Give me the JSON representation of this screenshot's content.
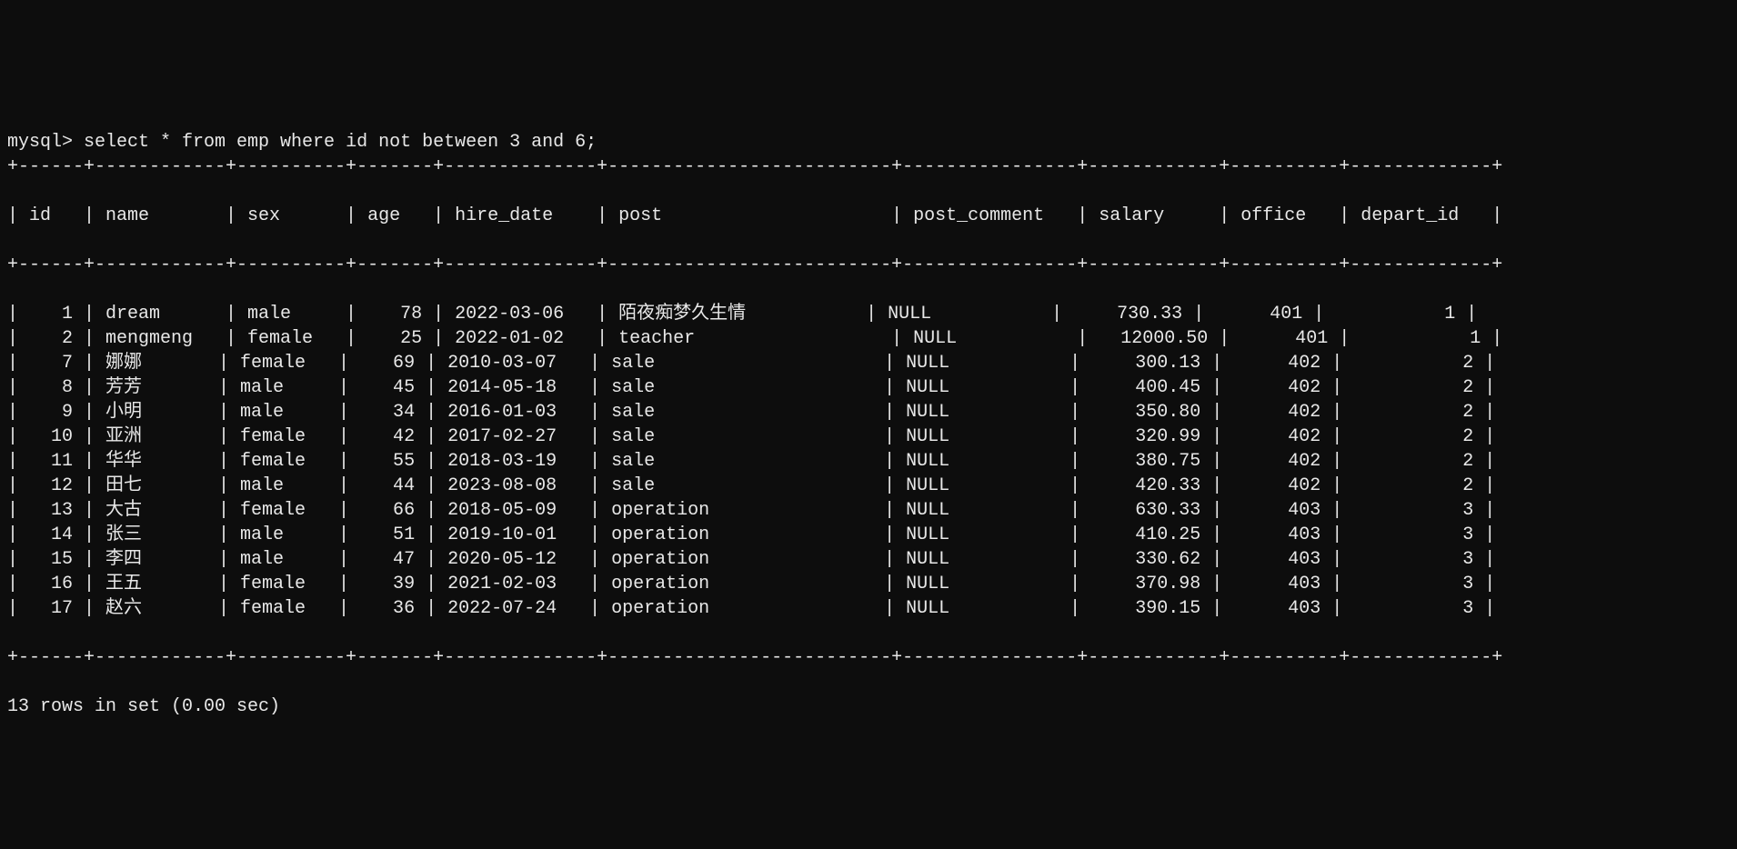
{
  "prompt": "mysql> ",
  "query": "select * from emp where id not between 3 and 6;",
  "columns": [
    {
      "name": "id",
      "width": 4,
      "align": "right"
    },
    {
      "name": "name",
      "width": 10,
      "align": "left"
    },
    {
      "name": "sex",
      "width": 8,
      "align": "left"
    },
    {
      "name": "age",
      "width": 5,
      "align": "right"
    },
    {
      "name": "hire_date",
      "width": 12,
      "align": "left"
    },
    {
      "name": "post",
      "width": 24,
      "align": "left"
    },
    {
      "name": "post_comment",
      "width": 14,
      "align": "left"
    },
    {
      "name": "salary",
      "width": 10,
      "align": "right"
    },
    {
      "name": "office",
      "width": 8,
      "align": "right"
    },
    {
      "name": "depart_id",
      "width": 11,
      "align": "right"
    }
  ],
  "rows": [
    {
      "id": "1",
      "name": "dream",
      "sex": "male",
      "age": "78",
      "hire_date": "2022-03-06",
      "post": "陌夜痴梦久生情",
      "post_comment": "NULL",
      "salary": "730.33",
      "office": "401",
      "depart_id": "1"
    },
    {
      "id": "2",
      "name": "mengmeng",
      "sex": "female",
      "age": "25",
      "hire_date": "2022-01-02",
      "post": "teacher",
      "post_comment": "NULL",
      "salary": "12000.50",
      "office": "401",
      "depart_id": "1"
    },
    {
      "id": "7",
      "name": "娜娜",
      "sex": "female",
      "age": "69",
      "hire_date": "2010-03-07",
      "post": "sale",
      "post_comment": "NULL",
      "salary": "300.13",
      "office": "402",
      "depart_id": "2"
    },
    {
      "id": "8",
      "name": "芳芳",
      "sex": "male",
      "age": "45",
      "hire_date": "2014-05-18",
      "post": "sale",
      "post_comment": "NULL",
      "salary": "400.45",
      "office": "402",
      "depart_id": "2"
    },
    {
      "id": "9",
      "name": "小明",
      "sex": "male",
      "age": "34",
      "hire_date": "2016-01-03",
      "post": "sale",
      "post_comment": "NULL",
      "salary": "350.80",
      "office": "402",
      "depart_id": "2"
    },
    {
      "id": "10",
      "name": "亚洲",
      "sex": "female",
      "age": "42",
      "hire_date": "2017-02-27",
      "post": "sale",
      "post_comment": "NULL",
      "salary": "320.99",
      "office": "402",
      "depart_id": "2"
    },
    {
      "id": "11",
      "name": "华华",
      "sex": "female",
      "age": "55",
      "hire_date": "2018-03-19",
      "post": "sale",
      "post_comment": "NULL",
      "salary": "380.75",
      "office": "402",
      "depart_id": "2"
    },
    {
      "id": "12",
      "name": "田七",
      "sex": "male",
      "age": "44",
      "hire_date": "2023-08-08",
      "post": "sale",
      "post_comment": "NULL",
      "salary": "420.33",
      "office": "402",
      "depart_id": "2"
    },
    {
      "id": "13",
      "name": "大古",
      "sex": "female",
      "age": "66",
      "hire_date": "2018-05-09",
      "post": "operation",
      "post_comment": "NULL",
      "salary": "630.33",
      "office": "403",
      "depart_id": "3"
    },
    {
      "id": "14",
      "name": "张三",
      "sex": "male",
      "age": "51",
      "hire_date": "2019-10-01",
      "post": "operation",
      "post_comment": "NULL",
      "salary": "410.25",
      "office": "403",
      "depart_id": "3"
    },
    {
      "id": "15",
      "name": "李四",
      "sex": "male",
      "age": "47",
      "hire_date": "2020-05-12",
      "post": "operation",
      "post_comment": "NULL",
      "salary": "330.62",
      "office": "403",
      "depart_id": "3"
    },
    {
      "id": "16",
      "name": "王五",
      "sex": "female",
      "age": "39",
      "hire_date": "2021-02-03",
      "post": "operation",
      "post_comment": "NULL",
      "salary": "370.98",
      "office": "403",
      "depart_id": "3"
    },
    {
      "id": "17",
      "name": "赵六",
      "sex": "female",
      "age": "36",
      "hire_date": "2022-07-24",
      "post": "operation",
      "post_comment": "NULL",
      "salary": "390.15",
      "office": "403",
      "depart_id": "3"
    }
  ],
  "footer": "13 rows in set (0.00 sec)"
}
